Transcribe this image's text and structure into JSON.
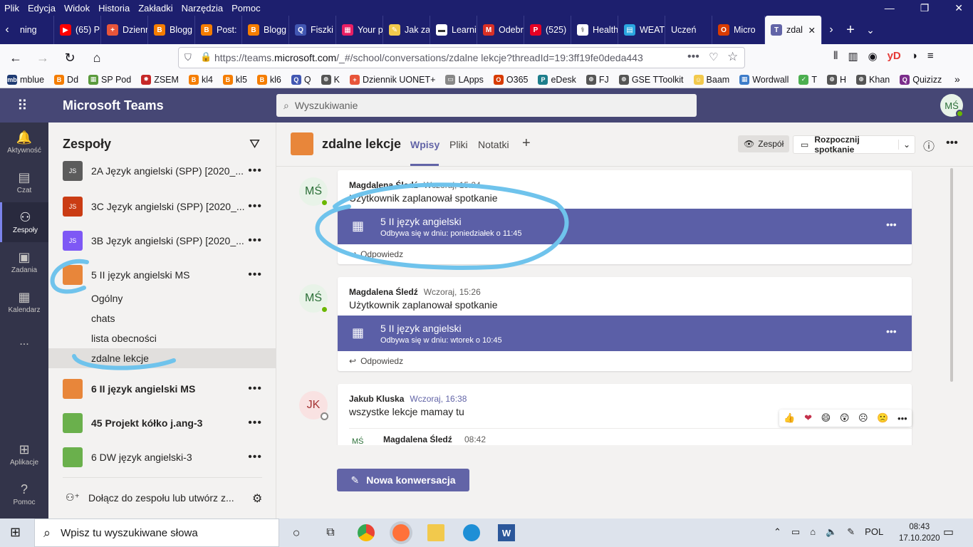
{
  "menubar": {
    "items": [
      "Plik",
      "Edycja",
      "Widok",
      "Historia",
      "Zakładki",
      "Narzędzia",
      "Pomoc"
    ]
  },
  "tabs": [
    {
      "title": "ning",
      "color": "#3a3a3a",
      "glyph": ""
    },
    {
      "title": "(65) P",
      "color": "#ff0000",
      "glyph": "▶"
    },
    {
      "title": "Dzienn",
      "color": "#e8553a",
      "glyph": "+"
    },
    {
      "title": "Blogg",
      "color": "#f57d00",
      "glyph": "B"
    },
    {
      "title": "Post: ",
      "color": "#f57d00",
      "glyph": "B"
    },
    {
      "title": "Blogg",
      "color": "#f57d00",
      "glyph": "B"
    },
    {
      "title": "Fiszki",
      "color": "#4257b2",
      "glyph": "Q"
    },
    {
      "title": "Your p",
      "color": "#e91e63",
      "glyph": "▦"
    },
    {
      "title": "Jak zal",
      "color": "#f2c94c",
      "glyph": "✎"
    },
    {
      "title": "Learni",
      "color": "#ffffff",
      "glyph": "▬"
    },
    {
      "title": "Odebr",
      "color": "#d93025",
      "glyph": "M"
    },
    {
      "title": "(525) ",
      "color": "#e60023",
      "glyph": "P"
    },
    {
      "title": "Health",
      "color": "#ffffff",
      "glyph": "⚕"
    },
    {
      "title": "WEATI",
      "color": "#2aa6e0",
      "glyph": "▤"
    },
    {
      "title": "Uczeń",
      "color": "",
      "glyph": ""
    },
    {
      "title": "Micro",
      "color": "#d83b01",
      "glyph": "O"
    },
    {
      "title": "zdal",
      "color": "#6264a7",
      "glyph": "T"
    }
  ],
  "nav": {
    "url_prefix": "https://teams.",
    "url_domain": "microsoft.com",
    "url_rest": "/_#/school/conversations/zdalne lekcje?threadId=19:3ff19fe0deda443"
  },
  "bookmarks": [
    {
      "label": "mblue",
      "color": "#1f3b73",
      "glyph": "mb"
    },
    {
      "label": "Dd",
      "color": "#f57d00",
      "glyph": "B"
    },
    {
      "label": "SP Pod",
      "color": "#5a9a3c",
      "glyph": "▦"
    },
    {
      "label": "ZSEM",
      "color": "#c62828",
      "glyph": "✸"
    },
    {
      "label": "kl4",
      "color": "#f57d00",
      "glyph": "B"
    },
    {
      "label": "kl5",
      "color": "#f57d00",
      "glyph": "B"
    },
    {
      "label": "kl6",
      "color": "#f57d00",
      "glyph": "B"
    },
    {
      "label": "Q",
      "color": "#4257b2",
      "glyph": "Q"
    },
    {
      "label": "K",
      "color": "#555",
      "glyph": "⊕"
    },
    {
      "label": "Dziennik UONET+",
      "color": "#e8553a",
      "glyph": "+"
    },
    {
      "label": "LApps",
      "color": "#888",
      "glyph": "▭"
    },
    {
      "label": "O365",
      "color": "#d83b01",
      "glyph": "O"
    },
    {
      "label": "eDesk",
      "color": "#1e7e8c",
      "glyph": "P"
    },
    {
      "label": "FJ",
      "color": "#555",
      "glyph": "⊕"
    },
    {
      "label": "GSE TToolkit",
      "color": "#555",
      "glyph": "⊕"
    },
    {
      "label": "Baam",
      "color": "#f2c94c",
      "glyph": "☺"
    },
    {
      "label": "Wordwall",
      "color": "#3d7cc9",
      "glyph": "▦"
    },
    {
      "label": "T",
      "color": "#4caf50",
      "glyph": "✓"
    },
    {
      "label": "H",
      "color": "#555",
      "glyph": "⊕"
    },
    {
      "label": "Khan",
      "color": "#555",
      "glyph": "⊕"
    },
    {
      "label": "Quizizz",
      "color": "#7b2d8b",
      "glyph": "Q"
    }
  ],
  "teams": {
    "app_title": "Microsoft Teams",
    "search_placeholder": "Wyszukiwanie",
    "user_initials": "MŚ"
  },
  "rail": [
    {
      "label": "Aktywność",
      "icon": "bell-icon",
      "glyph": "🔔"
    },
    {
      "label": "Czat",
      "icon": "chat-icon",
      "glyph": "▤"
    },
    {
      "label": "Zespoły",
      "icon": "teams-icon",
      "glyph": "⚇"
    },
    {
      "label": "Zadania",
      "icon": "assignments-icon",
      "glyph": "▣"
    },
    {
      "label": "Kalendarz",
      "icon": "calendar-icon",
      "glyph": "▦"
    },
    {
      "label": "...",
      "icon": "more-apps-icon",
      "glyph": ""
    },
    {
      "label": "Aplikacje",
      "icon": "apps-icon",
      "glyph": "⊞"
    },
    {
      "label": "Pomoc",
      "icon": "help-icon",
      "glyph": "?"
    }
  ],
  "teampanel": {
    "title": "Zespoły",
    "teams": [
      {
        "name": "2A Język angielski (SPP) [2020_...",
        "avatar_text": "JS",
        "color": "#5c5c5c",
        "bold": false
      },
      {
        "name": "3C Język angielski (SPP) [2020_...",
        "avatar_text": "JS",
        "color": "#ca3c14",
        "bold": false
      },
      {
        "name": "3B Język angielski (SPP) [2020_...",
        "avatar_text": "JS",
        "color": "#7e58f5",
        "bold": false
      },
      {
        "name": "5 II język angielski MS",
        "avatar_text": "",
        "color": "#e8863a",
        "bold": false
      },
      {
        "name": "6 II język angielski MS",
        "avatar_text": "",
        "color": "#e8863a",
        "bold": true
      },
      {
        "name": "45 Projekt kółko j.ang-3",
        "avatar_text": "",
        "color": "#6ab04c",
        "bold": true
      },
      {
        "name": "6 DW język angielski-3",
        "avatar_text": "",
        "color": "#6ab04c",
        "bold": false
      }
    ],
    "channels": [
      "Ogólny",
      "chats",
      "lista obecności",
      "zdalne lekcje"
    ],
    "join_label": "Dołącz do zespołu lub utwórz z..."
  },
  "channel": {
    "name": "zdalne lekcje",
    "tabs": [
      "Wpisy",
      "Pliki",
      "Notatki"
    ],
    "team_label": "Zespół",
    "meet_label": "Rozpocznij spotkanie"
  },
  "posts": [
    {
      "initials": "MŚ",
      "author": "Magdalena Śledź",
      "time": "Wczoraj, 15:24",
      "text": "Użytkownik zaplanował spotkanie",
      "meeting_title": "5 II język angielski",
      "meeting_sub": "Odbywa się w dniu: poniedziałek o 11:45",
      "reply": "Odpowiedz"
    },
    {
      "initials": "MŚ",
      "author": "Magdalena Śledź",
      "time": "Wczoraj, 15:26",
      "text": "Użytkownik zaplanował spotkanie",
      "meeting_title": "5 II język angielski",
      "meeting_sub": "Odbywa się w dniu: wtorek o 10:45",
      "reply": "Odpowiedz"
    },
    {
      "initials": "JK",
      "author": "Jakub Kluska",
      "time": "Wczoraj, 16:38",
      "text": "wszystke lekcje mamay tu",
      "reply_author": "Magdalena Śledź",
      "reply_time": "08:42",
      "reply_initials": "MŚ"
    }
  ],
  "reactions": [
    "👍",
    "❤",
    "😄",
    "😲",
    "☹",
    "🙁"
  ],
  "new_conversation": "Nowa konwersacja",
  "taskbar": {
    "search_placeholder": "Wpisz tu wyszukiwane słowa",
    "lang": "POL",
    "time": "08:43",
    "date": "17.10.2020"
  }
}
